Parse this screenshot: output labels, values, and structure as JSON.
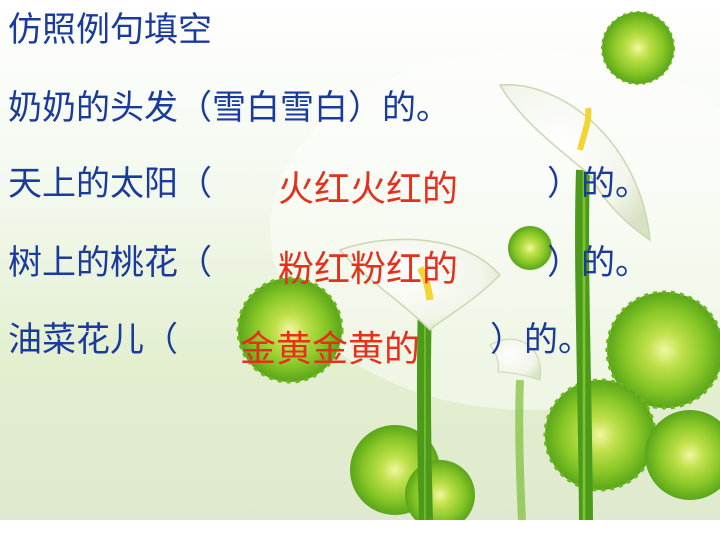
{
  "slide": {
    "title": "仿照例句填空",
    "example_line": "奶奶的头发（雪白雪白）的。",
    "items": [
      {
        "prefix": "天上的太阳（",
        "answer": "火红火红的",
        "suffix": "）的。"
      },
      {
        "prefix": "树上的桃花（",
        "answer": "粉红粉红的",
        "suffix": "）的。"
      },
      {
        "prefix": "油菜花儿（",
        "answer": "金黄金黄的",
        "suffix": "）的。"
      }
    ]
  },
  "colors": {
    "text": "#1a3b9c",
    "answer": "#e5311c",
    "flower_green": "#7cc41e",
    "lily_white": "#fdfdf8",
    "stem_green": "#5fae22"
  },
  "icons": [
    "chrysanthemum-flower",
    "calla-lily-flower"
  ]
}
